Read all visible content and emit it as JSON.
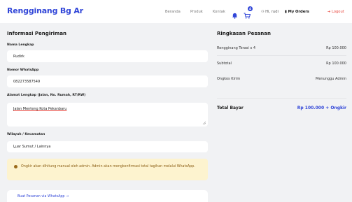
{
  "navbar": {
    "brand": "Rengginang Bg Ar",
    "links": [
      "Beranda",
      "Produk",
      "Kontak"
    ],
    "notification_icon": "bell-icon",
    "cart_icon": "cart-icon",
    "cart_count": "4",
    "user_label": "Hi, rudi",
    "orders_label": "My Orders",
    "logout_label": "Logout",
    "accent_color": "#3146d8",
    "logout_color": "#e8453c"
  },
  "shipping": {
    "title": "Informasi Pengiriman",
    "name_label": "Nama Lengkap",
    "name_value": "Rudirk",
    "phone_label": "Nomor WhatsApp",
    "phone_value": "082273587549",
    "address_label": "Alamat Lengkap (Jalan, No. Rumah, RT/RW)",
    "address_value": "Jalan Menteng Kota Pekanbaru",
    "region_label": "Wilayah / Kecamatan",
    "region_value": "Luar Sumut / Lainnya",
    "notice_text": "Ongkir akan dihitung manual oleh admin. Admin akan mengkonfirmasi total tagihan melalui WhatsApp.",
    "notice_color": "#fdf3cf",
    "submit_label": "Buat Pesanan via WhatsApp →"
  },
  "summary": {
    "title": "Ringkasan Pesanan",
    "item_label": "Rengginang Terasi x 4",
    "item_value": "Rp 100.000",
    "subtotal_label": "Subtotal",
    "subtotal_value": "Rp 100.000",
    "shipping_label": "Ongkos Kirim",
    "shipping_value": "Menunggu Admin",
    "total_label": "Total Bayar",
    "total_value": "Rp 100.000 + Ongkir"
  }
}
